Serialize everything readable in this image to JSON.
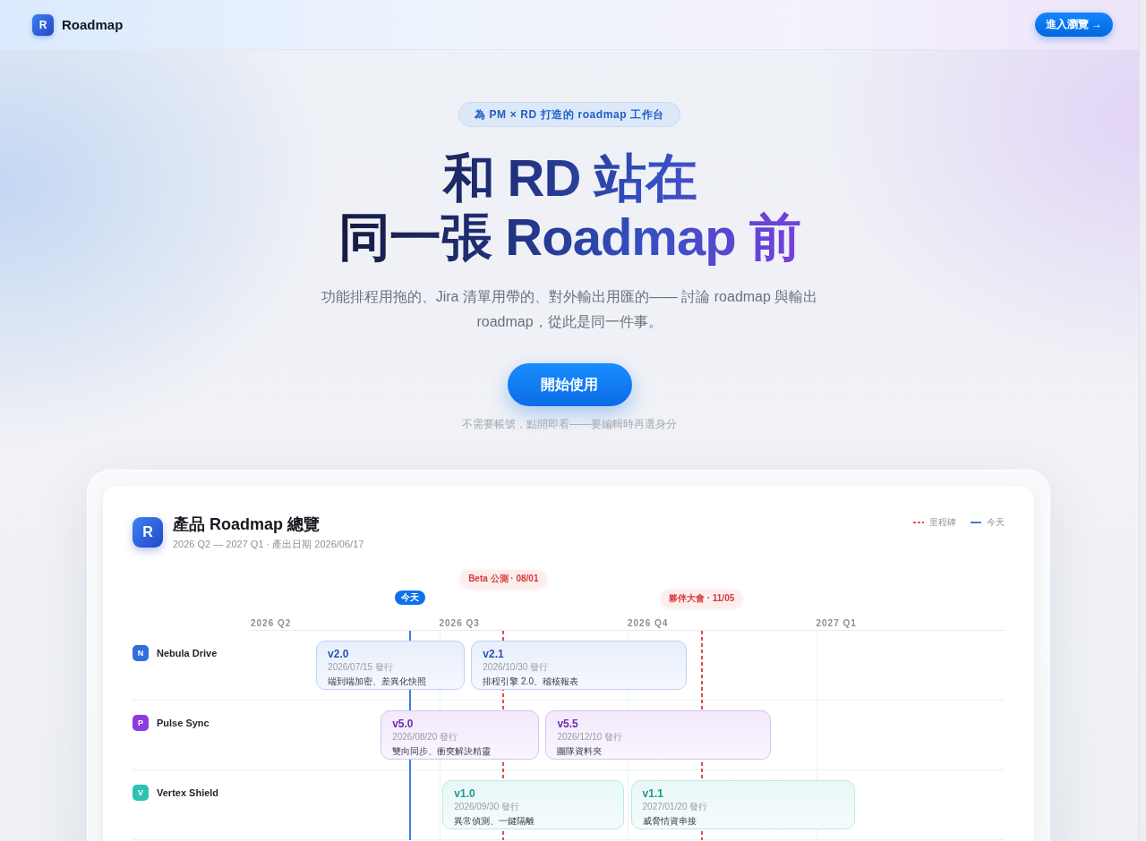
{
  "header": {
    "logo_letter": "R",
    "brand": "Roadmap",
    "browse_button": "進入瀏覽 →"
  },
  "hero": {
    "badge": "為 PM × RD 打造的 roadmap 工作台",
    "title_lines": [
      "和 RD 站在",
      "同一張 Roadmap 前"
    ],
    "subtitle": "功能排程用拖的、Jira 清單用帶的、對外輸出用匯的—— 討論 roadmap 與輸出 roadmap，從此是同一件事。",
    "cta_button": "開始使用",
    "hint": "不需要帳號，點開即看——要編輯時再選身分"
  },
  "roadmap": {
    "logo_letter": "R",
    "title": "產品 Roadmap 總覽",
    "subtitle": "2026 Q2 — 2027 Q1 · 產出日期 2026/06/17",
    "legend": [
      {
        "kind": "milestone",
        "label": "里程碑"
      },
      {
        "kind": "today",
        "label": "今天"
      }
    ],
    "today_marker": {
      "label": "今天"
    },
    "milestones": [
      {
        "label": "Beta 公測 · 08/01"
      },
      {
        "label": "夥伴大會 · 11/05"
      }
    ],
    "quarters": [
      "2026 Q2",
      "2026 Q3",
      "2026 Q4",
      "2027 Q1"
    ],
    "products": [
      {
        "initial": "N",
        "name": "Nebula Drive",
        "color": "#2f6ee0",
        "releases": [
          {
            "version": "v2.0",
            "date": "2026/07/15 發行",
            "summary": "端到端加密、差異化快照"
          },
          {
            "version": "v2.1",
            "date": "2026/10/30 發行",
            "summary": "排程引擎 2.0、稽核報表"
          }
        ]
      },
      {
        "initial": "P",
        "name": "Pulse Sync",
        "color": "#8e3ae0",
        "releases": [
          {
            "version": "v5.0",
            "date": "2026/08/20 發行",
            "summary": "雙向同步、衝突解決精靈"
          },
          {
            "version": "v5.5",
            "date": "2026/12/10 發行",
            "summary": "團隊資料夾"
          }
        ]
      },
      {
        "initial": "V",
        "name": "Vertex Shield",
        "color": "#2bc2b4",
        "releases": [
          {
            "version": "v1.0",
            "date": "2026/09/30 發行",
            "summary": "異常偵測、一鍵隔離"
          },
          {
            "version": "v1.1",
            "date": "2027/01/20 發行",
            "summary": "威脅情資串接"
          }
        ]
      }
    ]
  }
}
